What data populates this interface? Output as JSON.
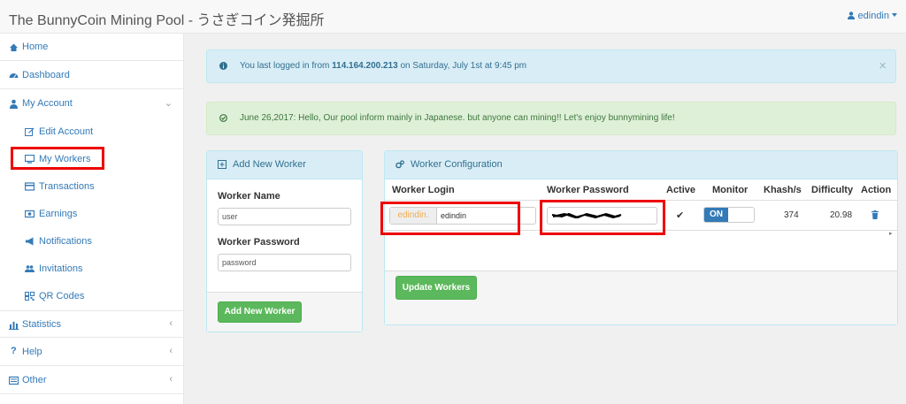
{
  "header": {
    "title": "The BunnyCoin Mining Pool - うさぎコイン発掘所",
    "username": "edindin"
  },
  "sidebar": {
    "items": [
      {
        "label": "Home",
        "icon": "home-icon"
      },
      {
        "label": "Dashboard",
        "icon": "dashboard-icon"
      },
      {
        "label": "My Account",
        "icon": "account-icon"
      },
      {
        "label": "Statistics",
        "icon": "bar-chart-icon"
      },
      {
        "label": "Help",
        "icon": "question-icon"
      },
      {
        "label": "Other",
        "icon": "list-icon"
      }
    ],
    "account_submenu": [
      {
        "label": "Edit Account",
        "icon": "edit-icon"
      },
      {
        "label": "My Workers",
        "icon": "monitor-icon"
      },
      {
        "label": "Transactions",
        "icon": "credit-card-icon"
      },
      {
        "label": "Earnings",
        "icon": "money-icon"
      },
      {
        "label": "Notifications",
        "icon": "bullhorn-icon"
      },
      {
        "label": "Invitations",
        "icon": "users-icon"
      },
      {
        "label": "QR Codes",
        "icon": "qrcode-icon"
      }
    ]
  },
  "alerts": {
    "login_prefix": "You last logged in from ",
    "login_ip": "114.164.200.213",
    "login_suffix": " on Saturday, July 1st at 9:45 pm",
    "news": "June 26,2017: Hello, Our pool inform mainly in Japanese. but anyone can mining!! Let's enjoy bunnymining life!"
  },
  "add_worker": {
    "title": "Add New Worker",
    "name_label": "Worker Name",
    "name_value": "user",
    "password_label": "Worker Password",
    "password_value": "password",
    "button": "Add New Worker"
  },
  "worker_config": {
    "title": "Worker Configuration",
    "columns": [
      "Worker Login",
      "Worker Password",
      "Active",
      "Monitor",
      "Khash/s",
      "Difficulty",
      "Action"
    ],
    "row": {
      "login_prefix": "edindin.",
      "login_value": "edindin",
      "active": "✔",
      "monitor": "ON",
      "khash": "374",
      "difficulty": "20.98"
    },
    "update_button": "Update Workers"
  },
  "colors": {
    "highlight": "#e00000",
    "primary": "#337ab7",
    "success": "#5cb85c",
    "info_bg": "#d9edf7",
    "success_bg": "#dff0d8"
  }
}
